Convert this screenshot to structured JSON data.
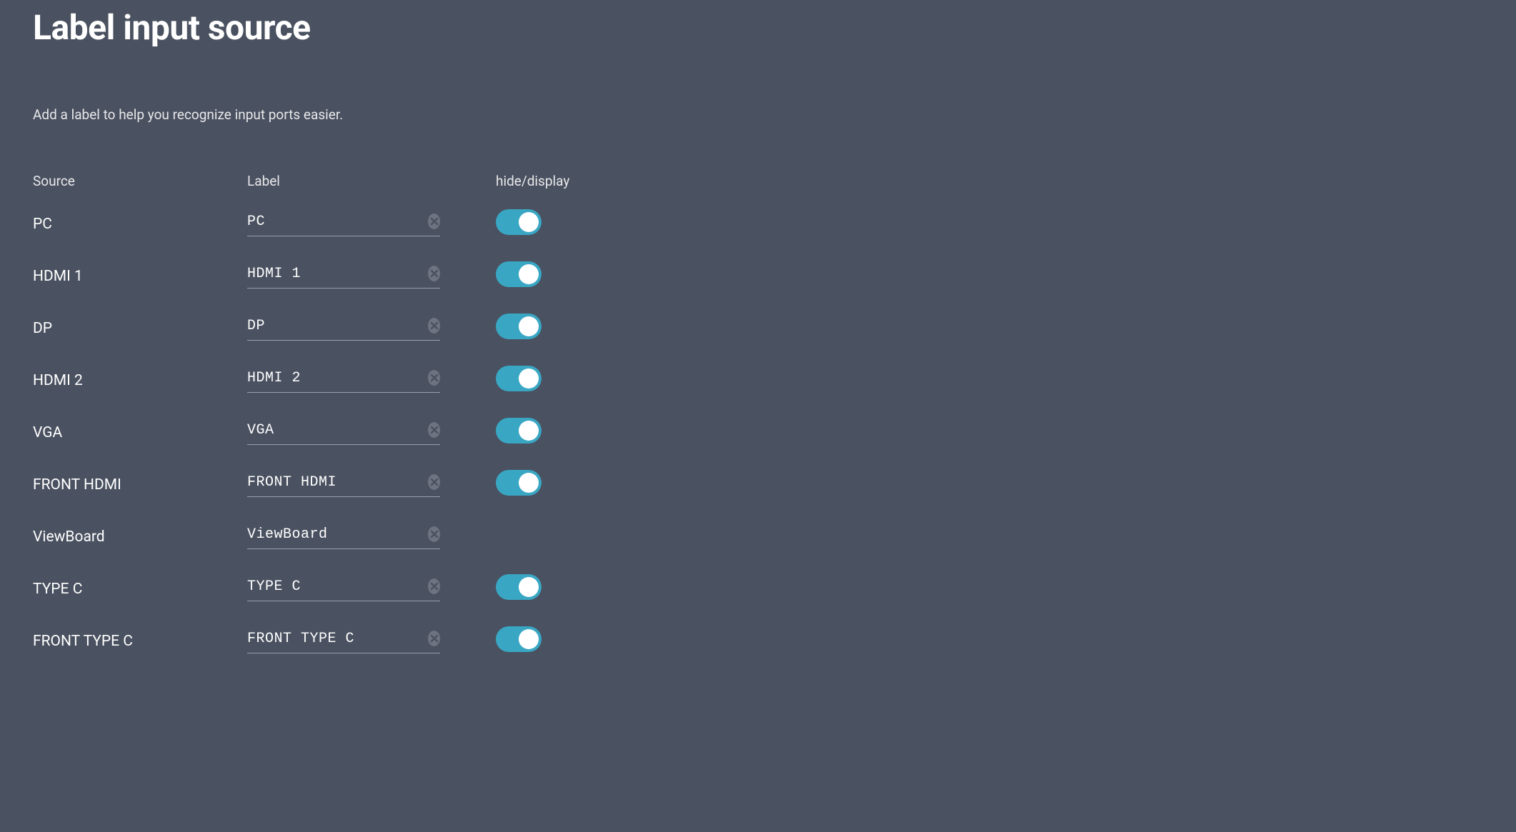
{
  "title": "Label input source",
  "subtitle": "Add a label to help you recognize input ports easier.",
  "columns": {
    "source": "Source",
    "label": "Label",
    "toggle": "hide/display"
  },
  "rows": [
    {
      "source": "PC",
      "label": "PC",
      "toggle": "on"
    },
    {
      "source": "HDMI 1",
      "label": "HDMI 1",
      "toggle": "on"
    },
    {
      "source": "DP",
      "label": "DP",
      "toggle": "on"
    },
    {
      "source": "HDMI 2",
      "label": "HDMI 2",
      "toggle": "on"
    },
    {
      "source": "VGA",
      "label": "VGA",
      "toggle": "on"
    },
    {
      "source": "FRONT HDMI",
      "label": "FRONT HDMI",
      "toggle": "on"
    },
    {
      "source": "ViewBoard",
      "label": "ViewBoard",
      "toggle": "none"
    },
    {
      "source": "TYPE C",
      "label": "TYPE C",
      "toggle": "on"
    },
    {
      "source": "FRONT TYPE C",
      "label": "FRONT TYPE C",
      "toggle": "on"
    }
  ],
  "icons": {
    "clear": "clear-icon"
  },
  "colors": {
    "background": "#4a5160",
    "accent": "#39a7c4"
  }
}
